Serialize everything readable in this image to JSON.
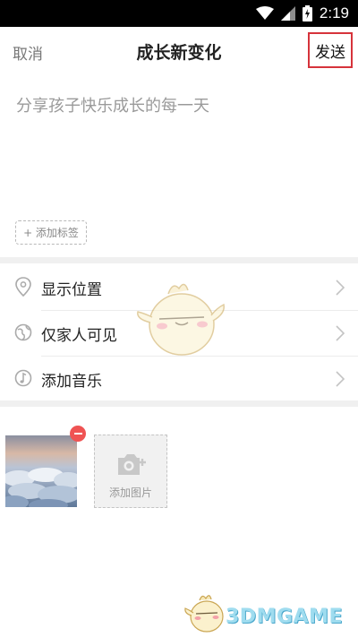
{
  "status_bar": {
    "time": "2:19"
  },
  "header": {
    "cancel_label": "取消",
    "title": "成长新变化",
    "send_label": "发送"
  },
  "post": {
    "placeholder": "分享孩子快乐成长的每一天",
    "add_tag_label": "+ 添加标签"
  },
  "options": [
    {
      "label": "显示位置",
      "icon": "location-pin-icon"
    },
    {
      "label": "仅家人可见",
      "icon": "privacy-icon"
    },
    {
      "label": "添加音乐",
      "icon": "music-note-icon"
    }
  ],
  "photos": {
    "add_photo_label": "添加图片"
  },
  "watermark": {
    "text": "3DMGAME"
  },
  "colors": {
    "send_border": "#d6333b",
    "remove_badge": "#ef5353",
    "watermark": "#9fdcef"
  }
}
